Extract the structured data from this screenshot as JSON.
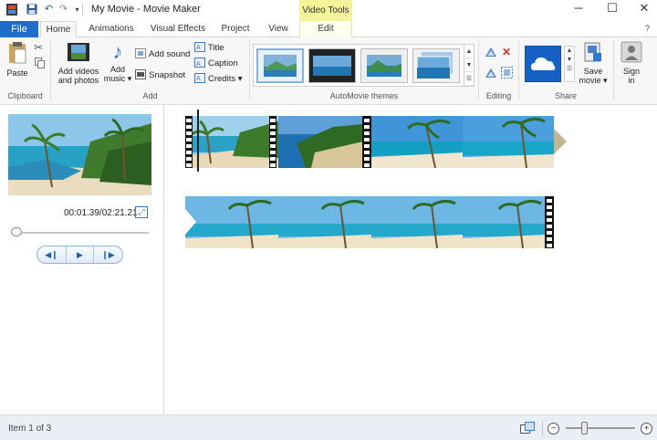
{
  "window": {
    "title": "My Movie - Movie Maker",
    "contextual_header": "Video Tools",
    "controls": [
      "minimize",
      "maximize",
      "close"
    ]
  },
  "tabs": [
    {
      "label": "File"
    },
    {
      "label": "Home",
      "active": true
    },
    {
      "label": "Animations"
    },
    {
      "label": "Visual Effects"
    },
    {
      "label": "Project"
    },
    {
      "label": "View"
    },
    {
      "label": "Edit"
    }
  ],
  "ribbon": {
    "clipboard": {
      "paste": "Paste",
      "group_label": "Clipboard"
    },
    "add": {
      "add_videos_line1": "Add videos",
      "add_videos_line2": "and photos",
      "add_music_line1": "Add",
      "add_music_line2": "music ▾",
      "add_sound": "Add sound",
      "snapshot": "Snapshot",
      "title": "Title",
      "caption": "Caption",
      "credits": "Credits ▾",
      "group_label": "Add"
    },
    "themes": {
      "group_label": "AutoMovie themes",
      "selected_index": 0
    },
    "editing": {
      "group_label": "Editing"
    },
    "share": {
      "group_label": "Share",
      "save_movie_line1": "Save",
      "save_movie_line2": "movie ▾",
      "sign_in_line1": "Sign",
      "sign_in_line2": "in"
    }
  },
  "preview": {
    "time": "00:01.39/02:21.21",
    "position_fraction": 0.01
  },
  "playback": {
    "prev": "◀❙",
    "play": "▶",
    "next": "❙▶"
  },
  "status": {
    "item_text": "Item 1 of 3",
    "zoom_fraction": 0.27
  },
  "colors": {
    "file_tab": "#1e6dc9",
    "video_tools": "#f5f39a",
    "accent": "#2b5797"
  }
}
